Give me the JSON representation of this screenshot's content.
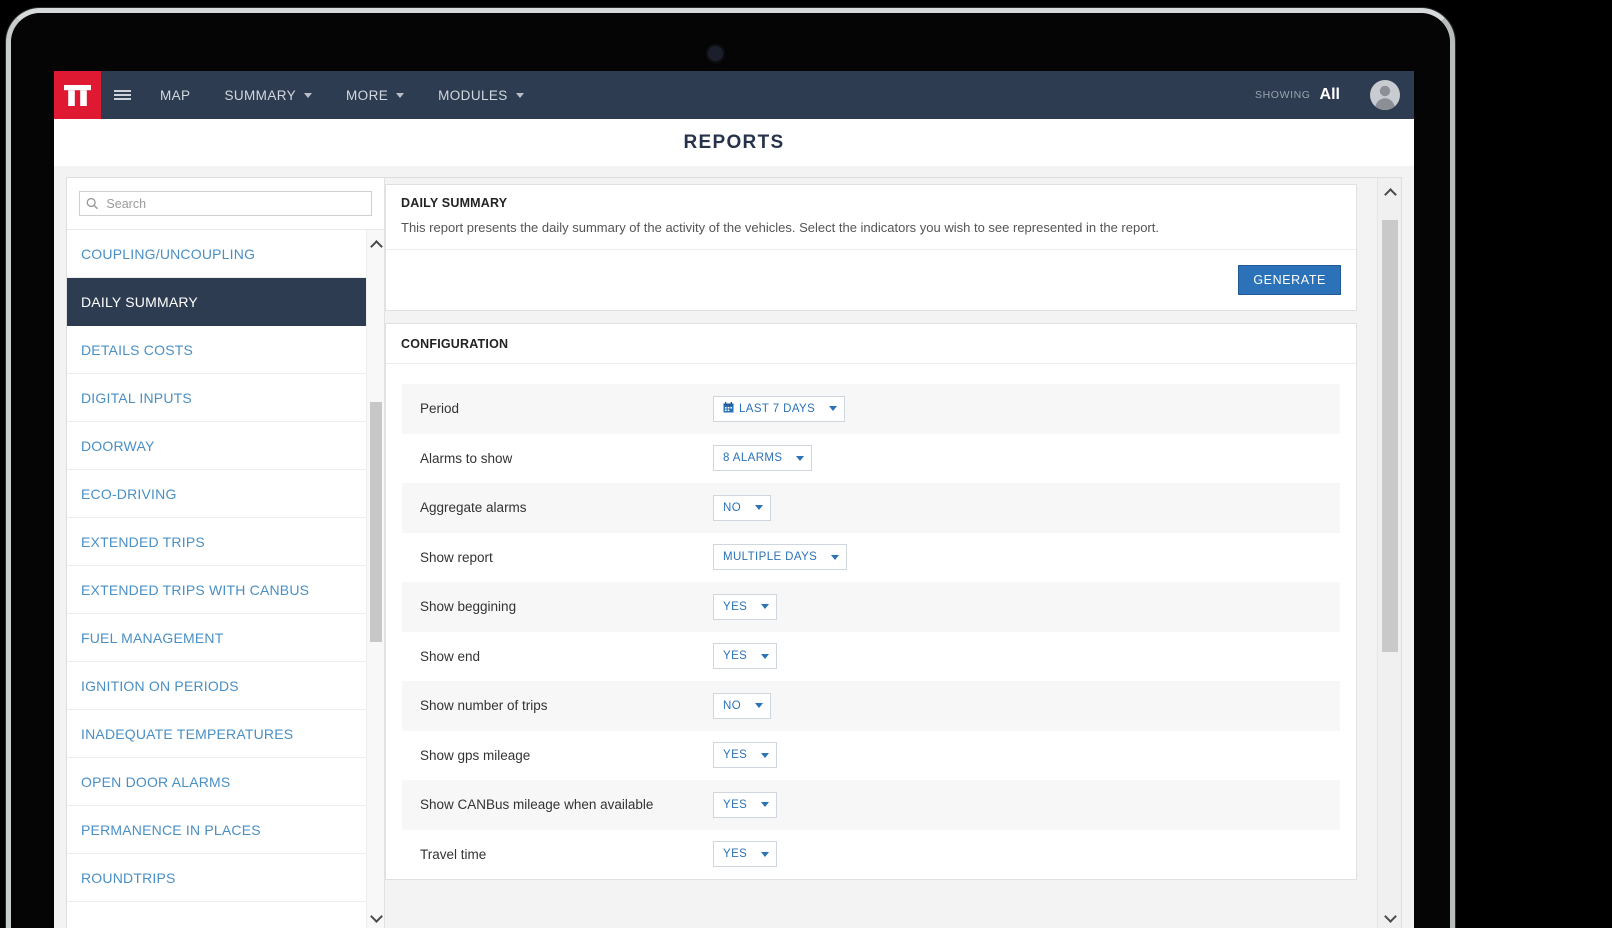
{
  "navbar": {
    "logo_name": "tt-logo",
    "menu_icon": "hamburger-icon",
    "items": [
      {
        "label": "MAP",
        "has_caret": false
      },
      {
        "label": "SUMMARY",
        "has_caret": true
      },
      {
        "label": "MORE",
        "has_caret": true
      },
      {
        "label": "MODULES",
        "has_caret": true
      }
    ],
    "showing_label": "SHOWING",
    "showing_value": "All",
    "avatar_name": "user-avatar"
  },
  "page": {
    "title": "REPORTS"
  },
  "search": {
    "value": "",
    "placeholder": "Search",
    "icon": "search-icon"
  },
  "sidebar": {
    "items": [
      {
        "label": "COUPLING/UNCOUPLING",
        "active": false
      },
      {
        "label": "DAILY SUMMARY",
        "active": true
      },
      {
        "label": "DETAILS COSTS",
        "active": false
      },
      {
        "label": "DIGITAL INPUTS",
        "active": false
      },
      {
        "label": "DOORWAY",
        "active": false
      },
      {
        "label": "ECO-DRIVING",
        "active": false
      },
      {
        "label": "EXTENDED TRIPS",
        "active": false
      },
      {
        "label": "EXTENDED TRIPS WITH CANBUS",
        "active": false
      },
      {
        "label": "FUEL MANAGEMENT",
        "active": false
      },
      {
        "label": "IGNITION ON PERIODS",
        "active": false
      },
      {
        "label": "INADEQUATE TEMPERATURES",
        "active": false
      },
      {
        "label": "OPEN DOOR ALARMS",
        "active": false
      },
      {
        "label": "PERMANENCE IN PLACES",
        "active": false
      },
      {
        "label": "ROUNDTRIPS",
        "active": false
      }
    ]
  },
  "report": {
    "title": "DAILY SUMMARY",
    "description": "This report presents the daily summary of the activity of the vehicles. Select the indicators you wish to see represented in the report.",
    "generate_label": "GENERATE"
  },
  "configuration": {
    "title": "CONFIGURATION",
    "rows": [
      {
        "label": "Period",
        "value": "LAST 7 DAYS",
        "icon": "calendar-icon"
      },
      {
        "label": "Alarms to show",
        "value": "8 ALARMS",
        "icon": ""
      },
      {
        "label": "Aggregate alarms",
        "value": "NO",
        "icon": ""
      },
      {
        "label": "Show report",
        "value": "MULTIPLE DAYS",
        "icon": ""
      },
      {
        "label": "Show beggining",
        "value": "YES",
        "icon": ""
      },
      {
        "label": "Show end",
        "value": "YES",
        "icon": ""
      },
      {
        "label": "Show number of trips",
        "value": "NO",
        "icon": ""
      },
      {
        "label": "Show gps mileage",
        "value": "YES",
        "icon": ""
      },
      {
        "label": "Show CANBus mileage when available",
        "value": "YES",
        "icon": ""
      },
      {
        "label": "Travel time",
        "value": "YES",
        "icon": ""
      }
    ]
  },
  "colors": {
    "navbar": "#2e3c51",
    "logo_red": "#e01933",
    "link_blue": "#4a8fc4",
    "accent_blue": "#2b72b8",
    "active_item": "#2e3c51"
  }
}
